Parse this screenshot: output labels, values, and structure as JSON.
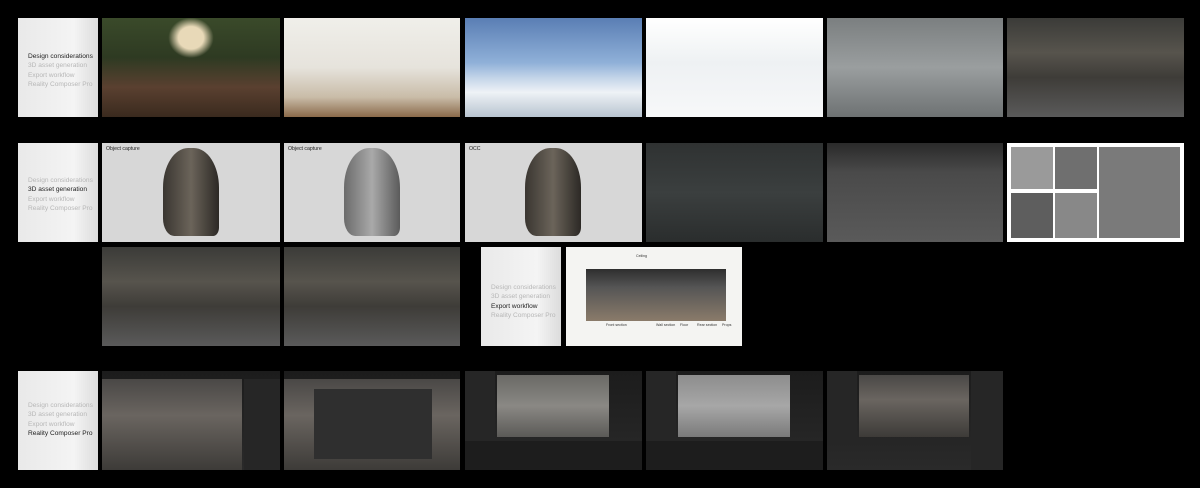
{
  "cards": [
    {
      "items": [
        "Design considerations",
        "3D asset generation",
        "Export workflow",
        "Reality Composer Pro"
      ],
      "active": 0
    },
    {
      "items": [
        "Design considerations",
        "3D asset generation",
        "Export workflow",
        "Reality Composer Pro"
      ],
      "active": 1
    },
    {
      "items": [
        "Design considerations",
        "3D asset generation",
        "Export workflow",
        "Reality Composer Pro"
      ],
      "active": 2
    },
    {
      "items": [
        "Design considerations",
        "3D asset generation",
        "Export workflow",
        "Reality Composer Pro"
      ],
      "active": 3
    }
  ],
  "object_labels": [
    "Object capture",
    "Object capture",
    "OCC"
  ],
  "diagram_labels": {
    "top": "Ceiling",
    "a": "Front section",
    "b": "Wall section",
    "c": "Floor",
    "d": "Rear section",
    "e": "Props"
  }
}
